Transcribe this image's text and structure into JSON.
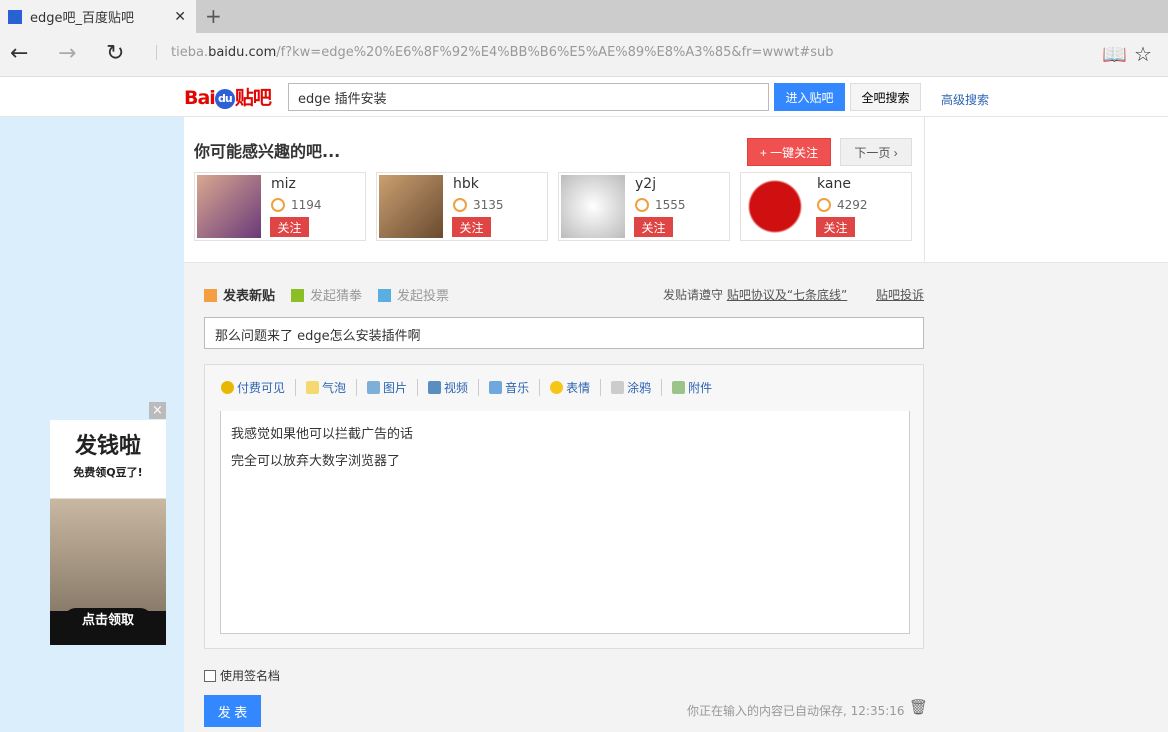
{
  "browser": {
    "tab_title": "edge吧_百度贴吧",
    "url_prefix": "tieba.",
    "url_domain": "baidu.com",
    "url_rest": "/f?kw=edge%20%E6%8F%92%E4%BB%B6%E5%AE%89%E8%A3%85&fr=wwwt#sub"
  },
  "header": {
    "logo_text": "Bai",
    "logo_du": "du",
    "logo_suffix": "贴吧",
    "search_value": "edge 插件安装",
    "enter_label": "进入贴吧",
    "all_search_label": "全吧搜索",
    "advanced_label": "高级搜索"
  },
  "recommend": {
    "title": "你可能感兴趣的吧...",
    "follow_all": "+ 一键关注",
    "next": "下一页 ›",
    "items": [
      {
        "name": "miz",
        "count": "1194",
        "follow": "关注"
      },
      {
        "name": "hbk",
        "count": "3135",
        "follow": "关注"
      },
      {
        "name": "y2j",
        "count": "1555",
        "follow": "关注"
      },
      {
        "name": "kane",
        "count": "4292",
        "follow": "关注"
      }
    ]
  },
  "post": {
    "tabs": [
      "发表新贴",
      "发起猜拳",
      "发起投票"
    ],
    "rules_prefix": "发贴请遵守",
    "rules_link": "贴吧协议及“七条底线”",
    "report": "贴吧投诉",
    "title_value": "那么问题来了   edge怎么安装插件啊",
    "tools": [
      "付费可见",
      "气泡",
      "图片",
      "视频",
      "音乐",
      "表情",
      "涂鸦",
      "附件"
    ],
    "body_lines": [
      "我感觉如果他可以拦截广告的话",
      "完全可以放弃大数字浏览器了"
    ],
    "signature": "使用签名档",
    "submit": "发 表",
    "autosave": "你正在输入的内容已自动保存, 12:35:16"
  },
  "ad": {
    "headline": "发钱啦",
    "sub": "免费领Q豆了!",
    "button": "点击领取",
    "close": "×"
  }
}
